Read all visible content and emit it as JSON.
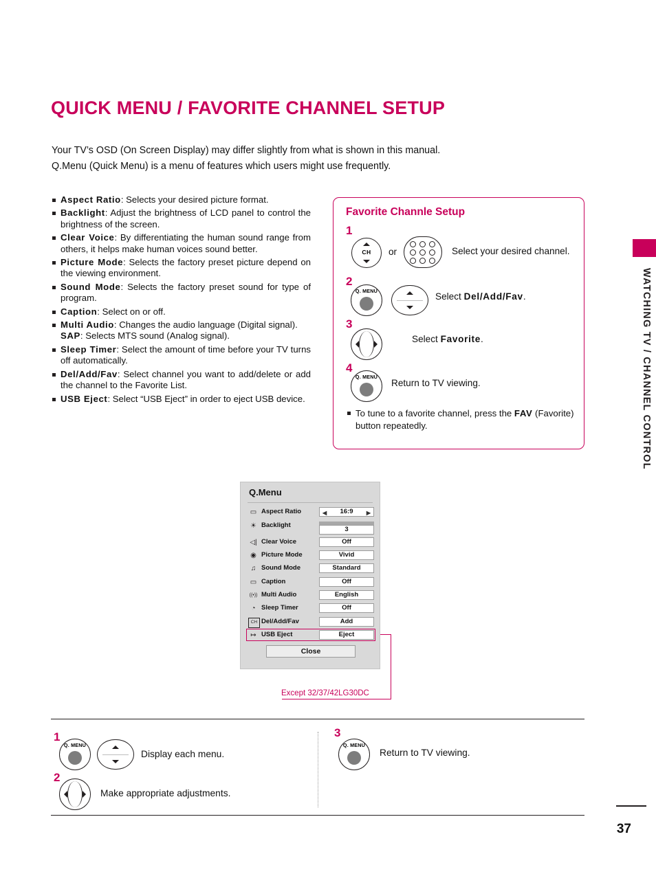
{
  "title": "QUICK MENU / FAVORITE CHANNEL SETUP",
  "intro": {
    "line1": "Your TV’s OSD (On Screen Display) may differ slightly from what is shown in this manual.",
    "line2": "Q.Menu (Quick Menu) is a menu of features which users might use frequently."
  },
  "bullets": [
    {
      "term": "Aspect Ratio",
      "desc": ": Selects your desired picture format."
    },
    {
      "term": "Backlight",
      "desc": ": Adjust the brightness of LCD panel to control the brightness of the screen."
    },
    {
      "term": "Clear Voice",
      "desc": ": By differentiating the human sound range from others, it helps make human voices sound better."
    },
    {
      "term": "Picture Mode",
      "desc": ": Selects the factory preset picture depend on the viewing environment."
    },
    {
      "term": "Sound Mode",
      "desc": ": Selects the factory preset sound for type of program."
    },
    {
      "term": "Caption",
      "desc": ": Select on or off."
    },
    {
      "term": "Multi Audio",
      "desc": ": Changes the audio language (Digital signal).",
      "sub_term": "SAP",
      "sub_desc": ": Selects MTS sound (Analog signal)."
    },
    {
      "term": "Sleep Timer",
      "desc": ": Select the amount of time before your TV turns off automatically."
    },
    {
      "term": "Del/Add/Fav",
      "desc": ": Select channel you want to add/delete or add the channel to the Favorite List."
    },
    {
      "term": "USB Eject",
      "desc": ": Select “USB Eject” in order to eject USB device."
    }
  ],
  "favorite_box": {
    "title": "Favorite Channle Setup",
    "steps": [
      {
        "num": "1",
        "button_label": "CH",
        "or_text": "or",
        "text": "Select your desired channel.",
        "bold": ""
      },
      {
        "num": "2",
        "button_label": "Q. MENU",
        "text_pre": "Select ",
        "bold": "Del/Add/Fav",
        "text_post": "."
      },
      {
        "num": "3",
        "text_pre": "Select ",
        "bold": "Favorite",
        "text_post": "."
      },
      {
        "num": "4",
        "button_label": "Q. MENU",
        "text_pre": "Return to TV viewing.",
        "bold": "",
        "text_post": ""
      }
    ],
    "note_pre": "To tune to a favorite channel, press the ",
    "note_bold": "FAV",
    "note_post": " (Favorite) button repeatedly."
  },
  "side_tab_text": "WATCHING TV / CHANNEL CONTROL",
  "osd": {
    "title": "Q.Menu",
    "rows": [
      {
        "icon": "▭",
        "icon_name": "aspect-ratio-icon",
        "label": "Aspect Ratio",
        "value": "16:9",
        "type": "arrows"
      },
      {
        "icon": "☀",
        "icon_name": "backlight-icon",
        "label": "Backlight",
        "value": "3",
        "type": "slider"
      },
      {
        "icon": "◁|",
        "icon_name": "clear-voice-icon",
        "label": "Clear Voice",
        "value": "Off",
        "type": "value"
      },
      {
        "icon": "◉",
        "icon_name": "picture-mode-icon",
        "label": "Picture Mode",
        "value": "Vivid",
        "type": "value"
      },
      {
        "icon": "♫",
        "icon_name": "sound-mode-icon",
        "label": "Sound Mode",
        "value": "Standard",
        "type": "value"
      },
      {
        "icon": "▭",
        "icon_name": "caption-icon",
        "label": "Caption",
        "value": "Off",
        "type": "value"
      },
      {
        "icon": "((•))",
        "icon_name": "multi-audio-icon",
        "label": "Multi Audio",
        "value": "English",
        "type": "value"
      },
      {
        "icon": "◔",
        "icon_name": "sleep-timer-icon",
        "label": "Sleep Timer",
        "value": "Off",
        "type": "value"
      },
      {
        "icon": "CH",
        "icon_name": "del-add-fav-icon",
        "label": "Del/Add/Fav",
        "value": "Add",
        "type": "value"
      },
      {
        "icon": "↦",
        "icon_name": "usb-eject-icon",
        "label": "USB Eject",
        "value": "Eject",
        "type": "value",
        "highlighted": true
      }
    ],
    "close_label": "Close",
    "except_note": "Except 32/37/42LG30DC"
  },
  "bottom_steps": [
    {
      "num": "1",
      "button_label": "Q. MENU",
      "text": "Display each menu."
    },
    {
      "num": "2",
      "text": "Make appropriate adjustments."
    },
    {
      "num": "3",
      "button_label": "Q. MENU",
      "text": "Return to TV viewing."
    }
  ],
  "page_number": "37",
  "colors": {
    "accent": "#c8005a",
    "text": "#111111",
    "osd_bg": "#d9d9d9"
  }
}
